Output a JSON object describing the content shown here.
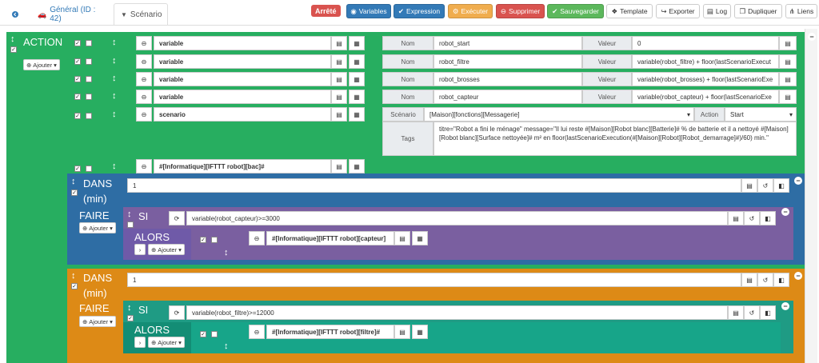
{
  "tabs": {
    "back_icon": "arrow-circle-left-icon",
    "general": "Général (ID : 42)",
    "scenario": "Scénario"
  },
  "toolbar": {
    "status": "Arrêté",
    "variables": "Variables",
    "expression": "Expression",
    "executer": "Exécuter",
    "supprimer": "Supprimer",
    "sauvegarder": "Sauvegarder",
    "template": "Template",
    "exporter": "Exporter",
    "log": "Log",
    "dupliquer": "Dupliquer",
    "liens": "Liens"
  },
  "colors": {
    "action": "#27ae60",
    "dans1": "#2e6da4",
    "si1": "#7a5fa0",
    "alors1": "#6f5aa8",
    "dans2": "#dd8a16",
    "si2": "#1f9b84",
    "alors2": "#17a589"
  },
  "action": {
    "title": "ACTION",
    "add": "Ajouter",
    "rows": [
      {
        "cmd": "variable",
        "name_label": "Nom",
        "name": "robot_start",
        "value_label": "Valeur",
        "value": "0"
      },
      {
        "cmd": "variable",
        "name_label": "Nom",
        "name": "robot_filtre",
        "value_label": "Valeur",
        "value": "variable(robot_filtre) + floor(lastScenarioExecut"
      },
      {
        "cmd": "variable",
        "name_label": "Nom",
        "name": "robot_brosses",
        "value_label": "Valeur",
        "value": "variable(robot_brosses) + floor(lastScenarioExe"
      },
      {
        "cmd": "variable",
        "name_label": "Nom",
        "name": "robot_capteur",
        "value_label": "Valeur",
        "value": "variable(robot_capteur) + floor(lastScenarioExe"
      }
    ],
    "scenario": {
      "cmd": "scenario",
      "scenario_label": "Scénario",
      "scenario_value": "[Maison][fonctions][Messagerie]",
      "action_label": "Action",
      "action_value": "Start",
      "tags_label": "Tags",
      "tags_value": "titre=\"Robot a fini le ménage\" message=\"Il lui reste  #[Maison][Robot blanc][Batterie]# % de batterie et il a nettoyé #[Maison][Robot blanc][Surface nettoyée]# m² en floor(lastScenarioExecution(#[Maison][Robot][Robot_demarrage]#)/60) min.\""
    },
    "last_cmd": "#[Informatique][IFTTT robot][bac]#"
  },
  "dans1": {
    "title": "DANS",
    "sub": "(min)",
    "value": "1",
    "faire": "FAIRE",
    "add": "Ajouter",
    "si": {
      "title": "SI",
      "condition": "variable(robot_capteur)>=3000",
      "alors": "ALORS",
      "add": "Ajouter",
      "cmd": "#[Informatique][IFTTT robot][capteur]"
    }
  },
  "dans2": {
    "title": "DANS",
    "sub": "(min)",
    "value": "1",
    "faire": "FAIRE",
    "add": "Ajouter",
    "si": {
      "title": "SI",
      "condition": "variable(robot_filtre)>=12000",
      "alors": "ALORS",
      "add": "Ajouter",
      "cmd": "#[Informatique][IFTTT robot][filtre]#"
    }
  }
}
